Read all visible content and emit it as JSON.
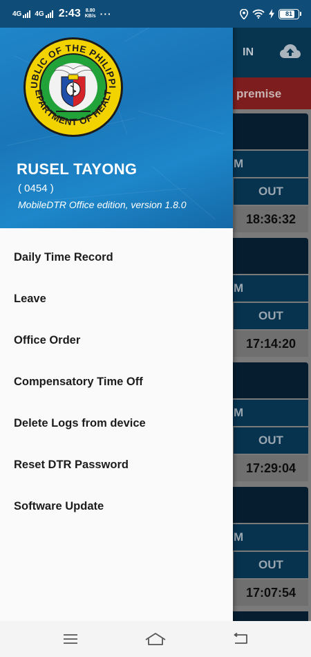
{
  "status_bar": {
    "network_1": "4G",
    "network_2": "4G",
    "time": "2:43",
    "speed_value": "8.80",
    "speed_unit": "KB/s",
    "more": "···",
    "battery": "81",
    "battery_level": 0.81
  },
  "background": {
    "toolbar_in": "IN",
    "banner_text": "premise",
    "cards": [
      {
        "m_label": "M",
        "out_label": "OUT",
        "time": "18:36:32"
      },
      {
        "m_label": "M",
        "out_label": "OUT",
        "time": "17:14:20"
      },
      {
        "m_label": "M",
        "out_label": "OUT",
        "time": "17:29:04"
      },
      {
        "m_label": "M",
        "out_label": "OUT",
        "time": "17:07:54"
      }
    ]
  },
  "drawer": {
    "logo": {
      "top_text": "REPUBLIC OF THE PHILIPPINES",
      "bottom_text": "DEPARTMENT OF HEALTH"
    },
    "user_name": "RUSEL TAYONG",
    "user_id": "( 0454 )",
    "app_version": "MobileDTR Office edition, version 1.8.0",
    "menu": [
      "Daily Time Record",
      "Leave",
      "Office Order",
      "Compensatory Time Off",
      "Delete Logs from device",
      "Reset DTR Password",
      "Software Update"
    ]
  },
  "colors": {
    "status_bar": "#0f4c78",
    "drawer_header": "#1d7fc4",
    "banner": "#7e1d1d"
  }
}
